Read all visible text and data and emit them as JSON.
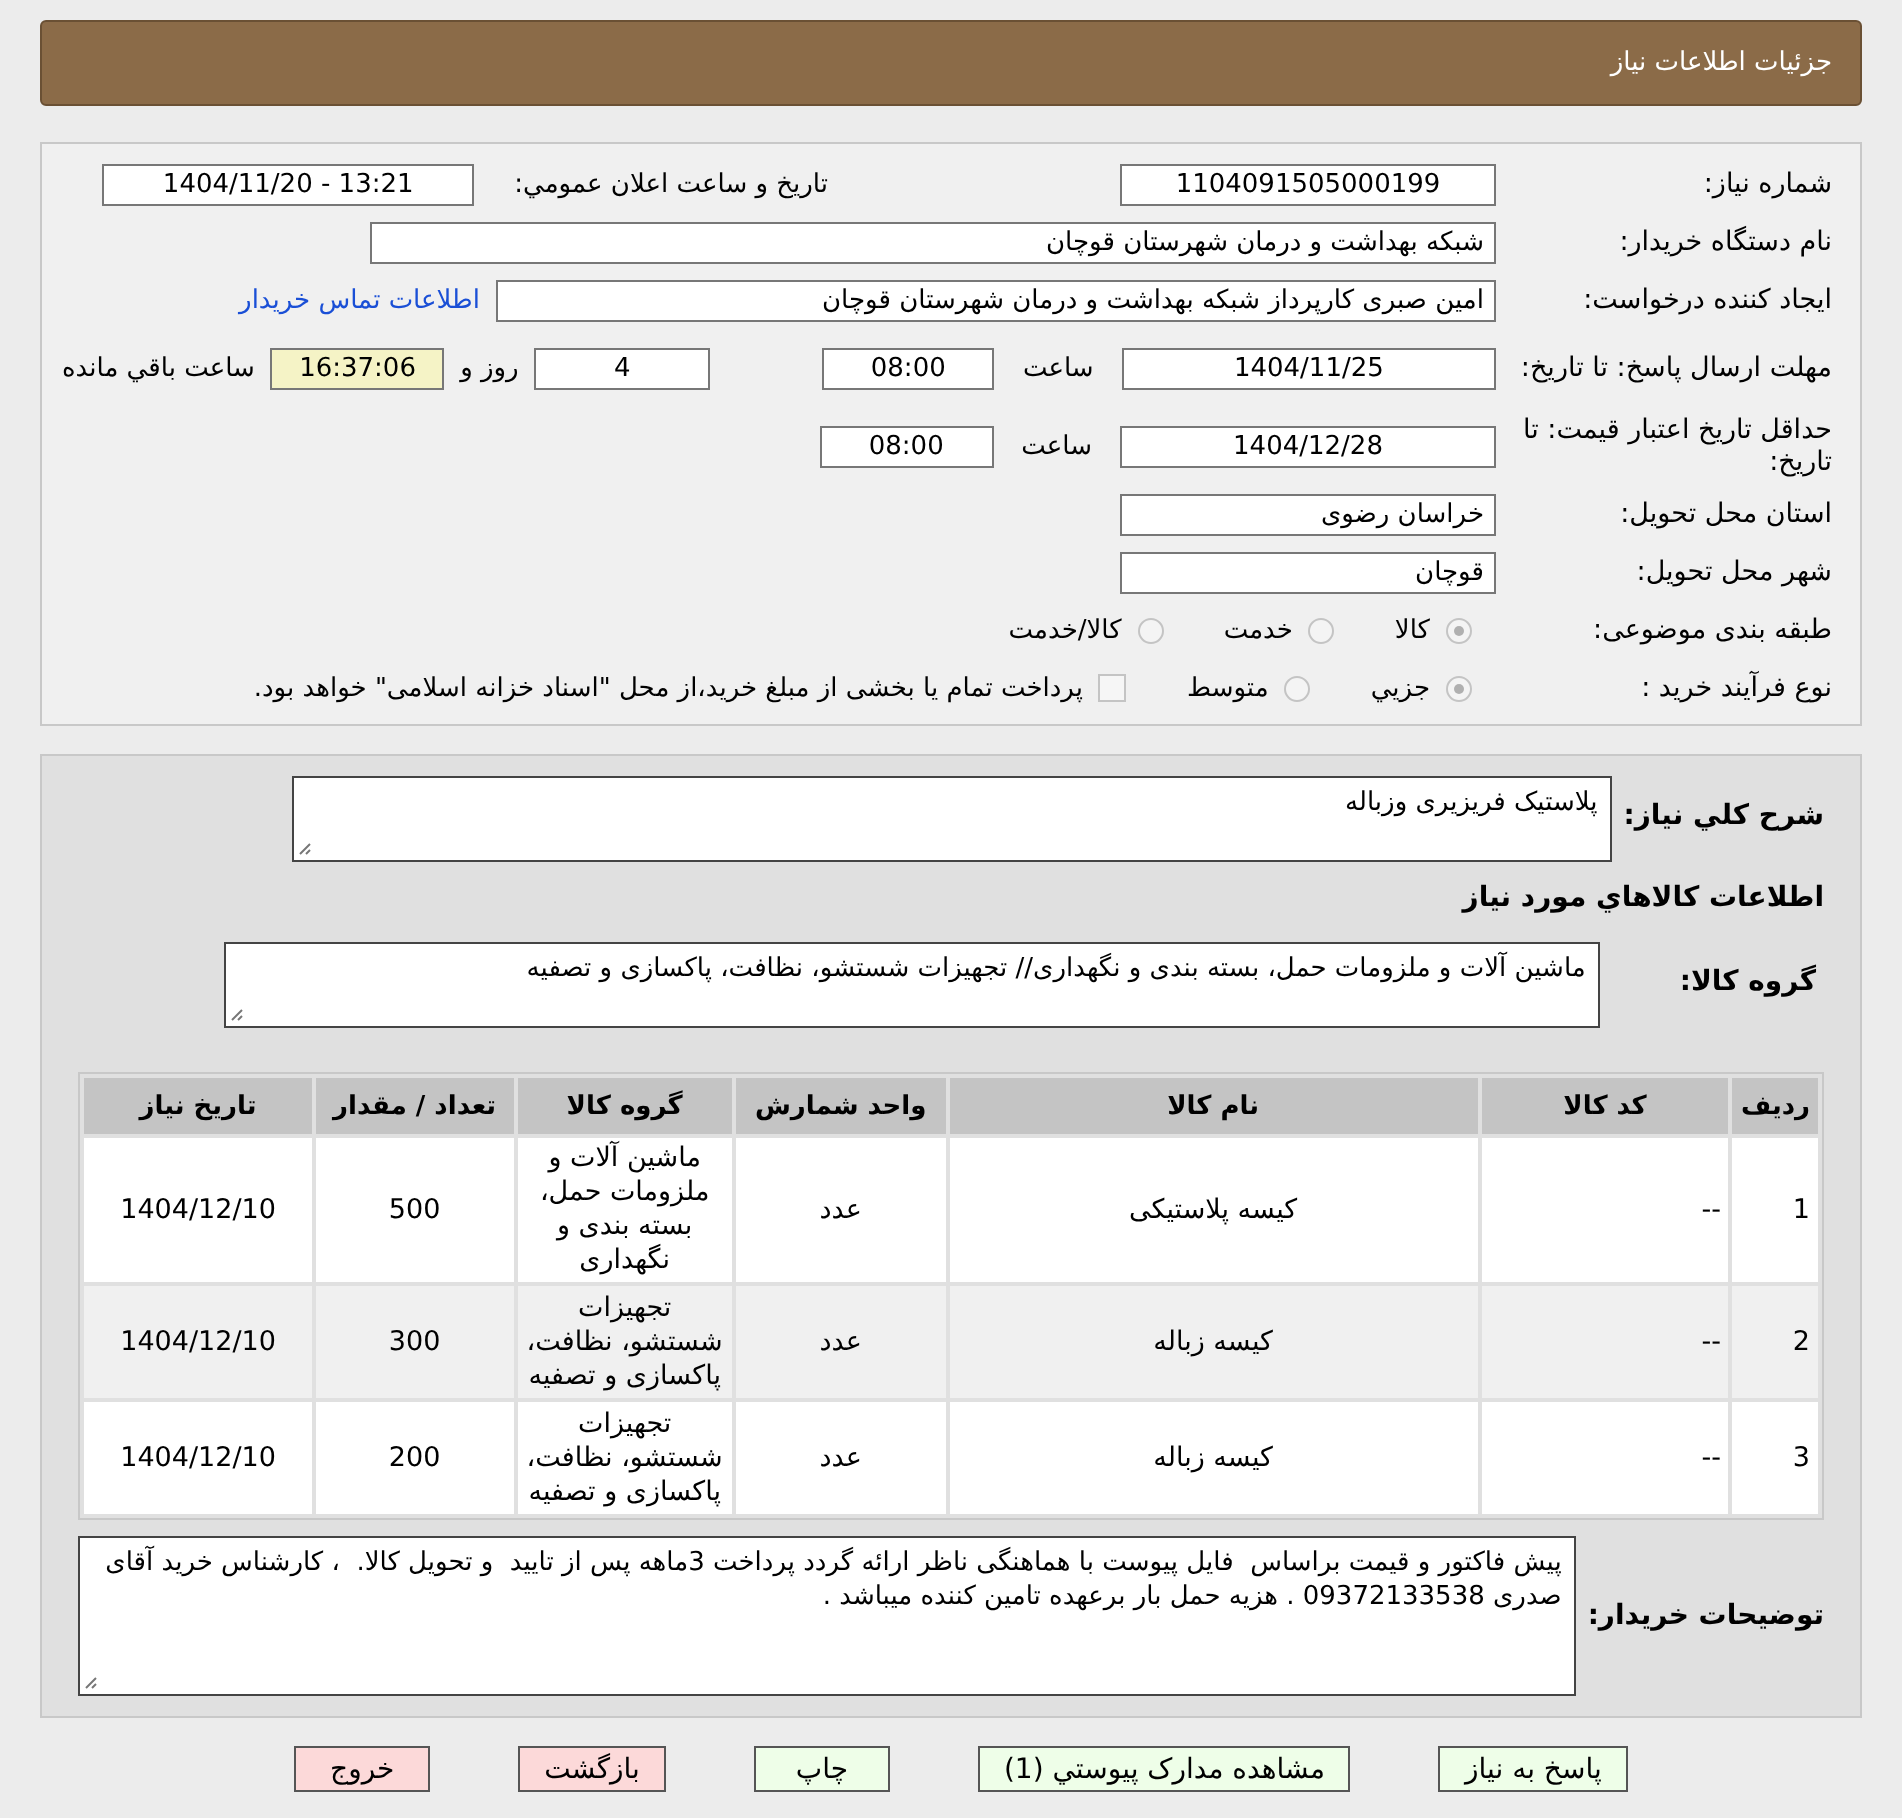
{
  "header": {
    "title": "جزئیات اطلاعات نیاز"
  },
  "info": {
    "need_number": {
      "label": "شماره نیاز:",
      "value": "1104091505000199"
    },
    "announce": {
      "label": "تاريخ و ساعت اعلان عمومي:",
      "value": "1404/11/20 - 13:21"
    },
    "buyer_org": {
      "label": "نام دستگاه خریدار:",
      "value": "شبکه بهداشت و درمان شهرستان قوچان"
    },
    "requester": {
      "label": "ایجاد کننده درخواست:",
      "value": "امین صبری کارپرداز شبکه بهداشت و درمان شهرستان قوچان",
      "link": "اطلاعات تماس خریدار"
    },
    "deadline": {
      "label": "مهلت ارسال پاسخ: تا تاریخ:",
      "date": "1404/11/25",
      "time_label": "ساعت",
      "time": "08:00",
      "days": "4",
      "days_label": "روز و",
      "remaining": "16:37:06",
      "remaining_label": "ساعت باقي مانده"
    },
    "validity": {
      "label": "حداقل تاریخ اعتبار قیمت: تا تاریخ:",
      "date": "1404/12/28",
      "time_label": "ساعت",
      "time": "08:00"
    },
    "province": {
      "label": "استان محل تحویل:",
      "value": "خراسان رضوی"
    },
    "city": {
      "label": "شهر محل تحویل:",
      "value": "قوچان"
    },
    "category": {
      "label": "طبقه بندی موضوعی:",
      "options": [
        {
          "label": "کالا",
          "selected": true
        },
        {
          "label": "خدمت",
          "selected": false
        },
        {
          "label": "کالا/خدمت",
          "selected": false
        }
      ]
    },
    "process": {
      "label": "نوع فرآیند خرید :",
      "options": [
        {
          "label": "جزيي",
          "selected": true
        },
        {
          "label": "متوسط",
          "selected": false
        }
      ],
      "note_checked": false,
      "note": "پرداخت تمام یا بخشی از مبلغ خرید،از محل \"اسناد خزانه اسلامی\" خواهد بود."
    }
  },
  "summary": {
    "label": "شرح کلي نياز:",
    "value": "پلاستیک فریزیری وزباله"
  },
  "goods_title": "اطلاعات کالاهاي مورد نياز",
  "group": {
    "label": "گروه کالا:",
    "value": "ماشین آلات و ملزومات حمل، بسته بندی و نگهداری// تجهیزات شستشو، نظافت، پاکسازی و تصفیه"
  },
  "table": {
    "columns": [
      "رديف",
      "کد کالا",
      "نام کالا",
      "واحد شمارش",
      "گروه کالا",
      "تعداد / مقدار",
      "تاريخ نياز"
    ],
    "rows": [
      {
        "cells": [
          "1",
          "--",
          "کیسه پلاستیکی",
          "عدد",
          "ماشین آلات و ملزومات حمل، بسته بندی و نگهداری",
          "500",
          "1404/12/10"
        ]
      },
      {
        "cells": [
          "2",
          "--",
          "کیسه زباله",
          "عدد",
          "تجهیزات شستشو، نظافت، پاکسازی و تصفیه",
          "300",
          "1404/12/10"
        ]
      },
      {
        "cells": [
          "3",
          "--",
          "کیسه زباله",
          "عدد",
          "تجهیزات شستشو، نظافت، پاکسازی و تصفیه",
          "200",
          "1404/12/10"
        ]
      }
    ]
  },
  "notes": {
    "label": "توضیحات خریدار:",
    "value": "پیش فاکتور و قیمت براساس  فایل پیوست با هماهنگی ناظر ارائه گردد پرداخت 3ماهه پس از تایید  و تحویل کالا.  ، کارشناس خرید آقای صدری 09372133538 . هزیه حمل بار برعهده تامین کننده میباشد ."
  },
  "buttons": [
    {
      "label": "پاسخ به نیاز",
      "kind": "green"
    },
    {
      "label": "مشاهده مدارک پیوستي (1)",
      "kind": "green"
    },
    {
      "label": "چاپ",
      "kind": "green"
    },
    {
      "label": "بازگشت",
      "kind": "red"
    },
    {
      "label": "خروج",
      "kind": "red"
    }
  ]
}
